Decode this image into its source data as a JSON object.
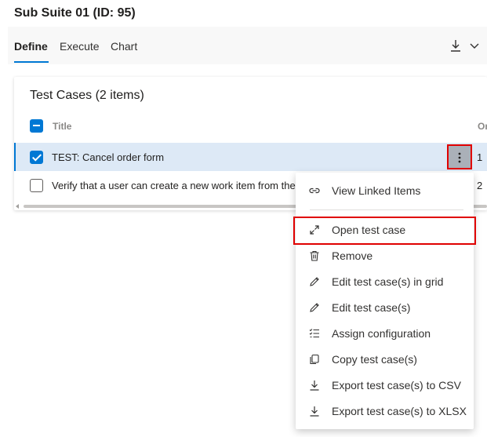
{
  "header": {
    "title": "Sub Suite 01 (ID: 95)"
  },
  "tabs": [
    {
      "label": "Define",
      "active": true
    },
    {
      "label": "Execute",
      "active": false
    },
    {
      "label": "Chart",
      "active": false
    }
  ],
  "toolbar": {
    "icons": [
      "download-icon",
      "chevron-down-icon"
    ]
  },
  "grid": {
    "title": "Test Cases (2 items)",
    "columns": [
      "Title",
      "Or"
    ],
    "rows": [
      {
        "title": "TEST: Cancel order form",
        "order": "1",
        "selected": true
      },
      {
        "title": "Verify that a user can create a new work item from the",
        "order": "2",
        "selected": false
      }
    ]
  },
  "context_menu": {
    "items": [
      {
        "label": "View Linked Items",
        "icon": "link-icon"
      },
      {
        "label": "Open test case",
        "icon": "expand-icon",
        "highlighted": true
      },
      {
        "label": "Remove",
        "icon": "trash-icon"
      },
      {
        "label": "Edit test case(s) in grid",
        "icon": "pencil-icon"
      },
      {
        "label": "Edit test case(s)",
        "icon": "pencil-icon"
      },
      {
        "label": "Assign configuration",
        "icon": "checklist-icon"
      },
      {
        "label": "Copy test case(s)",
        "icon": "copy-icon"
      },
      {
        "label": "Export test case(s) to CSV",
        "icon": "download-icon"
      },
      {
        "label": "Export test case(s) to XLSX",
        "icon": "download-icon"
      }
    ]
  },
  "colors": {
    "accent": "#0078d4",
    "highlight_border": "#e00000",
    "selected_row": "#dde9f6"
  }
}
